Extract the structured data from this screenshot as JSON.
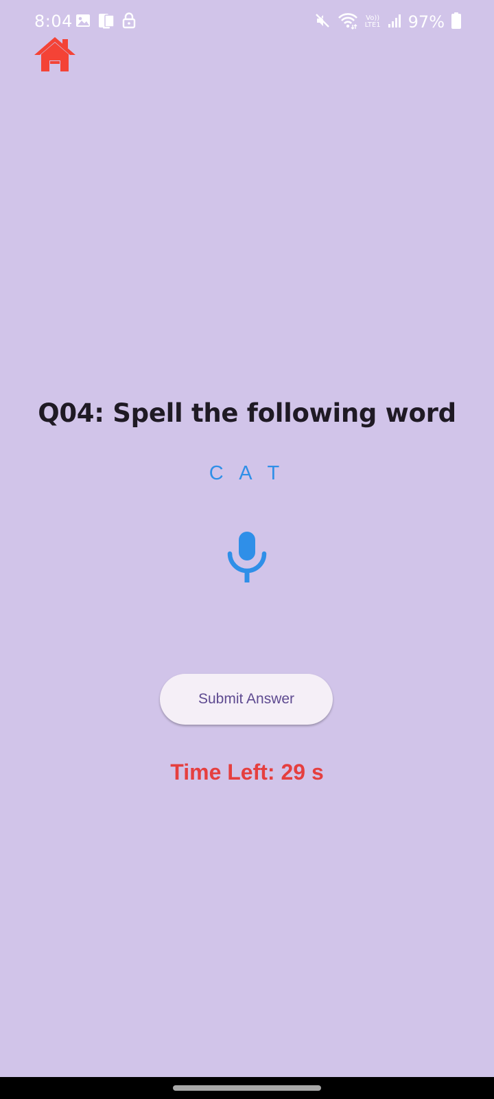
{
  "status_bar": {
    "time": "8:04",
    "left_icons": [
      "gallery-icon",
      "screen-mirror-icon",
      "lock-icon"
    ],
    "right_icons": [
      "mute-icon",
      "wifi-icon",
      "volte-icon",
      "signal-icon",
      "battery-icon"
    ],
    "volte_line1": "Vo))",
    "volte_line2": "LTE1",
    "battery_percent": "97%"
  },
  "header": {
    "home_icon": "home-icon",
    "home_color": "#f44336"
  },
  "question": {
    "title": "Q04: Spell the following word",
    "word": "C A T",
    "word_color": "#2f8fe8",
    "mic_icon": "microphone-icon"
  },
  "actions": {
    "submit_label": "Submit Answer"
  },
  "timer": {
    "text": "Time Left: 29 s",
    "color": "#e53f3f"
  },
  "theme": {
    "background": "#d1c4e9",
    "button_background": "#f5eff7",
    "button_text": "#5e4a90",
    "title_color": "#1f1a24"
  }
}
